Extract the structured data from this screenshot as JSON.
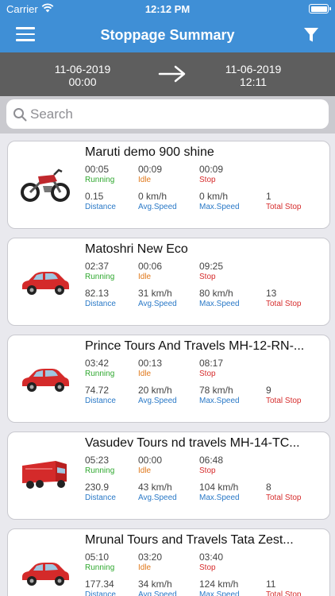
{
  "status_bar": {
    "carrier": "Carrier",
    "time": "12:12 PM"
  },
  "header": {
    "title": "Stoppage Summary"
  },
  "date_range": {
    "from_date": "11-06-2019",
    "from_time": "00:00",
    "to_date": "11-06-2019",
    "to_time": "12:11"
  },
  "search": {
    "placeholder": "Search"
  },
  "labels": {
    "running": "Running",
    "idle": "Idle",
    "stop": "Stop",
    "distance": "Distance",
    "avg_speed": "Avg.Speed",
    "max_speed": "Max.Speed",
    "total_stop": "Total Stop"
  },
  "vehicles": [
    {
      "name": "Maruti demo   900 shine",
      "type": "bike",
      "running": "00:05",
      "idle": "00:09",
      "stop": "00:09",
      "distance": "0.15",
      "avg_speed": "0 km/h",
      "max_speed": "0 km/h",
      "total_stop": "1"
    },
    {
      "name": "Matoshri   New Eco",
      "type": "car",
      "running": "02:37",
      "idle": "00:06",
      "stop": "09:25",
      "distance": "82.13",
      "avg_speed": "31 km/h",
      "max_speed": "80 km/h",
      "total_stop": "13"
    },
    {
      "name": "Prince Tours And Travels   MH-12-RN-...",
      "type": "car",
      "running": "03:42",
      "idle": "00:13",
      "stop": "08:17",
      "distance": "74.72",
      "avg_speed": "20 km/h",
      "max_speed": "78 km/h",
      "total_stop": "9"
    },
    {
      "name": "Vasudev Tours nd travels   MH-14-TC...",
      "type": "truck",
      "running": "05:23",
      "idle": "00:00",
      "stop": "06:48",
      "distance": "230.9",
      "avg_speed": "43 km/h",
      "max_speed": "104 km/h",
      "total_stop": "8"
    },
    {
      "name": "Mrunal Tours and Travels   Tata Zest...",
      "type": "car",
      "running": "05:10",
      "idle": "03:20",
      "stop": "03:40",
      "distance": "177.34",
      "avg_speed": "34 km/h",
      "max_speed": "124 km/h",
      "total_stop": "11"
    }
  ],
  "colors": {
    "header": "#3f8fd6",
    "date_bar": "#5e5e5e",
    "running": "#2fa82f",
    "idle": "#e0781b",
    "stop": "#d62d2d",
    "label_blue": "#2a79c7",
    "vehicle_red": "#d42a2a"
  }
}
